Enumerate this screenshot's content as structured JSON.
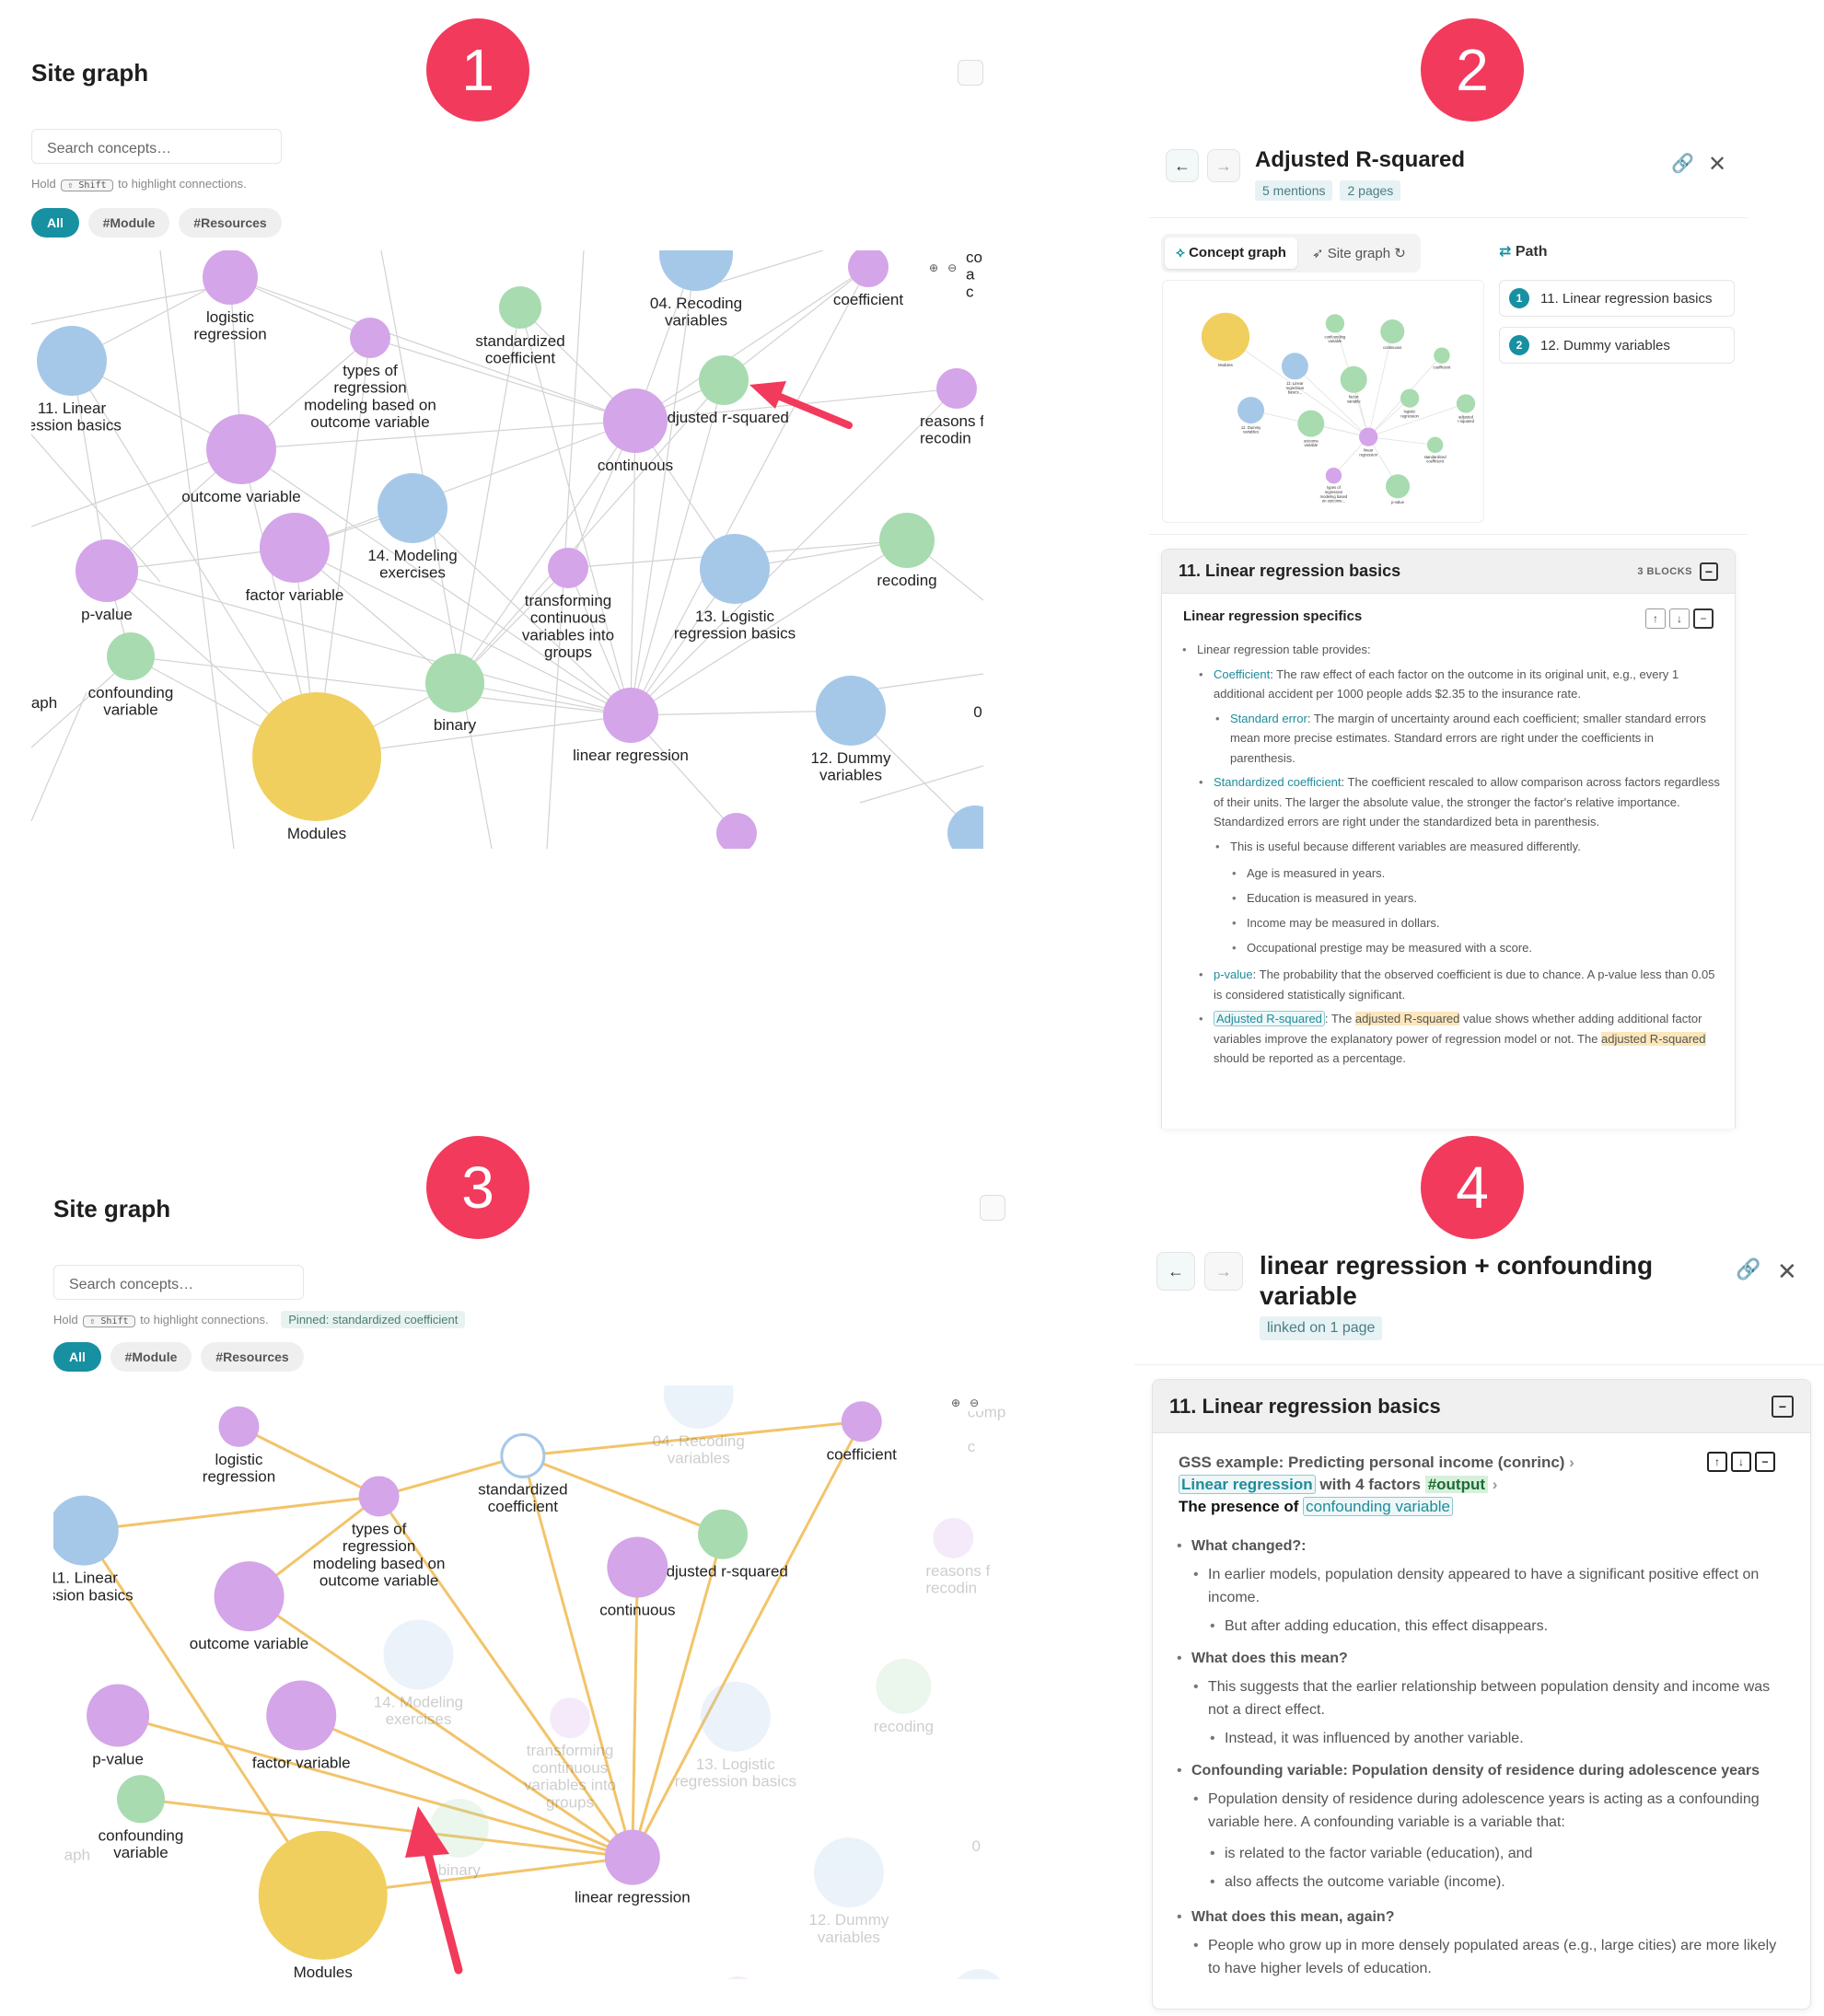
{
  "panel1": {
    "badge": "1",
    "title": "Site graph",
    "search_placeholder": "Search concepts…",
    "hint_pre": "Hold",
    "hint_key": "⇧ Shift",
    "hint_post": "to highlight connections.",
    "chips": [
      "All",
      "#Module",
      "#Resources"
    ],
    "nodes": {
      "logistic": "logistic\nregression",
      "std": "standardized\ncoefficient",
      "recoding04": "04. Recoding\nvariables",
      "coefficient": "coefficient",
      "comp": "comp\na\nc",
      "lin11": "11. Linear\nression basics",
      "types": "types of\nregression\nmodeling based on\noutcome variable",
      "adjusted": "adjusted r-squared",
      "reasons": "reasons f\nrecodin",
      "continuous": "continuous",
      "outcome": "outcome variable",
      "modeling14": "14. Modeling\nexercises",
      "recoding": "recoding",
      "pvalue": "p-value",
      "factor": "factor variable",
      "transforming": "transforming\ncontinuous\nvariables into\ngroups",
      "logistic13": "13. Logistic\nregression basics",
      "confounding": "confounding\nvariable",
      "aph": "aph",
      "binary": "binary",
      "linreg": "linear regression",
      "dummy12": "12. Dummy\nvariables",
      "zero": "0",
      "modules": "Modules"
    }
  },
  "panel2": {
    "badge": "2",
    "title": "Adjusted R-squared",
    "mentions": "5 mentions",
    "pages": "2 pages",
    "tab_concept": "Concept graph",
    "tab_site": "Site graph",
    "path_label": "Path",
    "path_items": [
      "11. Linear regression basics",
      "12. Dummy variables"
    ],
    "mini_nodes": {
      "modules": "Modules",
      "confounding": "confounding\nvariable",
      "continuous": "continuous",
      "coefficient": "coefficient",
      "lin11": "11. Linear\nregression\nbasics...",
      "factor": "factor\nvariable",
      "logistic": "logistic\nregression",
      "adjusted": "adjusted\nr-squared",
      "dummy12": "12. Dummy\nvariables",
      "outcome": "outcome\nvariable",
      "linreg": "linear\nregression",
      "std": "standardized\ncoefficient",
      "types": "types of\nregression\nmodeling based\non outcome...",
      "pvalue": "p-value"
    },
    "card_title": "11. Linear regression basics",
    "card_blocks": "3 BLOCKS",
    "section_title": "Linear regression specifics",
    "b0": "Linear regression table provides:",
    "b1_term": "Coefficient",
    "b1_text": ": The raw effect of each factor on the outcome in its original unit, e.g., every 1 additional accident per 1000 people adds $2.35 to the insurance rate.",
    "b2_term": "Standard error",
    "b2_text": ": The margin of uncertainty around each coefficient; smaller standard errors mean more precise estimates. Standard errors are right under the coefficients in parenthesis.",
    "b3_term": "Standardized coefficient",
    "b3_text": ": The coefficient rescaled to allow comparison across factors regardless of their units. The larger the absolute value, the stronger the factor's relative importance. Standardized errors are right under the standardized beta in parenthesis.",
    "b4": "This is useful because different variables are measured differently.",
    "b5": "Age is measured in years.",
    "b6": "Education is measured in years.",
    "b7": "Income may be measured in dollars.",
    "b8": "Occupational prestige may be measured with a score.",
    "b9_term": "p-value",
    "b9_text": ": The probability that the observed coefficient is due to chance. A p-value less than 0.05 is considered statistically significant.",
    "b10_term": "Adjusted R-squared",
    "b10_a": ": The ",
    "b10_hl1": "adjusted R-squared",
    "b10_b": " value shows whether adding additional factor variables improve the explanatory power of regression model or not. The ",
    "b10_hl2": "adjusted R-squared",
    "b10_c": " should be reported as a percentage."
  },
  "panel3": {
    "badge": "3",
    "title": "Site graph",
    "search_placeholder": "Search concepts…",
    "hint_pre": "Hold",
    "hint_key": "⇧ Shift",
    "hint_post": "to highlight connections.",
    "pinned": "Pinned: standardized coefficient",
    "chips": [
      "All",
      "#Module",
      "#Resources"
    ],
    "nodes": {
      "logistic": "logistic\nregression",
      "recoding04": "04. Recoding\nvariables",
      "coefficient": "coefficient",
      "comp": "comp\n \nc",
      "std": "standardized\ncoefficient",
      "lin11": "11. Linear\nression basics",
      "types": "types of\nregression\nmodeling based on\noutcome variable",
      "adjusted": "adjusted r-squared",
      "reasons": "reasons f\nrecodin",
      "continuous": "continuous",
      "outcome": "outcome variable",
      "modeling14": "14. Modeling\nexercises",
      "recoding": "recoding",
      "factor": "factor variable",
      "transforming": "transforming\ncontinuous\nvariables into\ngroups",
      "logistic13": "13. Logistic\nregression basics",
      "pvalue": "p-value",
      "confounding": "confounding\nvariable",
      "aph": "aph",
      "binary": "binary",
      "zero": "0",
      "linreg": "linear regression",
      "dummy12": "12. Dummy\nvariables",
      "modules": "Modules"
    }
  },
  "panel4": {
    "badge": "4",
    "title": "linear regression + confounding variable",
    "linked": "linked on 1 page",
    "card_title": "11. Linear regression basics",
    "block_head_1": "GSS example: Predicting personal income (conrinc)",
    "block_head_2a": "Linear regression",
    "block_head_2b": " with 4 factors ",
    "block_head_2c": "#output",
    "block_head_3a": "The presence of ",
    "block_head_3b": "confounding variable",
    "q1": "What changed?:",
    "q1a": "In earlier models, population density appeared to have a significant positive effect on income.",
    "q1b": "But after adding education, this effect disappears.",
    "q2": "What does this mean?",
    "q2a": "This suggests that the earlier relationship between population density and income was not a direct effect.",
    "q2b": "Instead, it was influenced by another variable.",
    "q3": "Confounding variable: Population density of residence during adolescence years",
    "q3a": "Population density of residence during adolescence years is acting as a confounding variable here. A confounding variable is a variable that:",
    "q3b": "is related to the factor variable (education), and",
    "q3c": "also affects the outcome variable (income).",
    "q4": "What does this mean, again?",
    "q4a": "People who grow up in more densely populated areas (e.g., large cities) are more likely to have higher levels of education."
  },
  "colors": {
    "purple": "#d4a5e8",
    "blue": "#a6c8e8",
    "green": "#a8dbb0",
    "yellow": "#f0cf5e",
    "orange_edge": "#f2c46a",
    "accent": "#1790a2",
    "badge": "#f23a5c"
  }
}
